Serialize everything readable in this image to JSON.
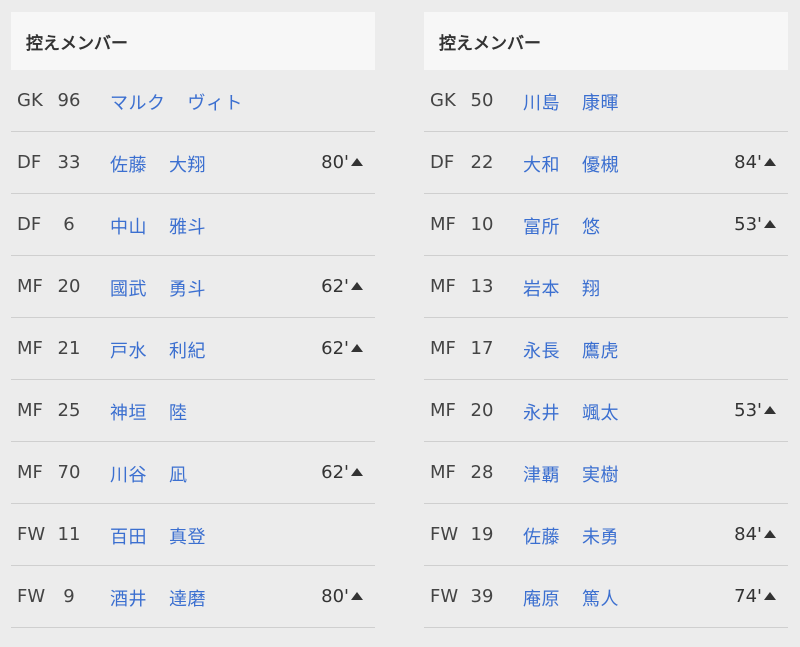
{
  "left": {
    "header": "控えメンバー",
    "rows": [
      {
        "pos": "GK",
        "num": "96",
        "family": "マルク",
        "given": "ヴィト",
        "sub": ""
      },
      {
        "pos": "DF",
        "num": "33",
        "family": "佐藤",
        "given": "大翔",
        "sub": "80'"
      },
      {
        "pos": "DF",
        "num": "6",
        "family": "中山",
        "given": "雅斗",
        "sub": ""
      },
      {
        "pos": "MF",
        "num": "20",
        "family": "國武",
        "given": "勇斗",
        "sub": "62'"
      },
      {
        "pos": "MF",
        "num": "21",
        "family": "戸水",
        "given": "利紀",
        "sub": "62'"
      },
      {
        "pos": "MF",
        "num": "25",
        "family": "神垣",
        "given": "陸",
        "sub": ""
      },
      {
        "pos": "MF",
        "num": "70",
        "family": "川谷",
        "given": "凪",
        "sub": "62'"
      },
      {
        "pos": "FW",
        "num": "11",
        "family": "百田",
        "given": "真登",
        "sub": ""
      },
      {
        "pos": "FW",
        "num": "9",
        "family": "酒井",
        "given": "達磨",
        "sub": "80'"
      }
    ]
  },
  "right": {
    "header": "控えメンバー",
    "rows": [
      {
        "pos": "GK",
        "num": "50",
        "family": "川島",
        "given": "康暉",
        "sub": ""
      },
      {
        "pos": "DF",
        "num": "22",
        "family": "大和",
        "given": "優槻",
        "sub": "84'"
      },
      {
        "pos": "MF",
        "num": "10",
        "family": "富所",
        "given": "悠",
        "sub": "53'"
      },
      {
        "pos": "MF",
        "num": "13",
        "family": "岩本",
        "given": "翔",
        "sub": ""
      },
      {
        "pos": "MF",
        "num": "17",
        "family": "永長",
        "given": "鷹虎",
        "sub": ""
      },
      {
        "pos": "MF",
        "num": "20",
        "family": "永井",
        "given": "颯太",
        "sub": "53'"
      },
      {
        "pos": "MF",
        "num": "28",
        "family": "津覇",
        "given": "実樹",
        "sub": ""
      },
      {
        "pos": "FW",
        "num": "19",
        "family": "佐藤",
        "given": "未勇",
        "sub": "84'"
      },
      {
        "pos": "FW",
        "num": "39",
        "family": "庵原",
        "given": "篤人",
        "sub": "74'"
      }
    ]
  },
  "icons": {
    "sub_in": "triangle-up-icon"
  },
  "colors": {
    "link": "#3b6fd0",
    "header_bg": "#f7f7f7",
    "page_bg": "#ececec",
    "divider": "#cfcfcf"
  }
}
